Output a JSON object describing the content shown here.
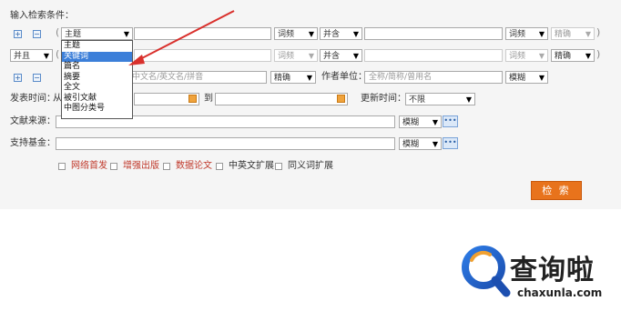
{
  "header": {
    "title": "输入检索条件："
  },
  "row1": {
    "field_select": "主题",
    "freq1": "词频",
    "logic": "并含",
    "freq2": "词频",
    "match": "精确"
  },
  "field_dropdown": {
    "options": [
      "主题",
      "关键词",
      "篇名",
      "摘要",
      "全文",
      "被引文献",
      "中图分类号"
    ],
    "highlighted_index": 1
  },
  "row2": {
    "conj": "并且",
    "freq1": "词频",
    "logic": "并含",
    "freq2": "词频",
    "match": "精确"
  },
  "row3": {
    "author_placeholder": "中文名/英文名/拼音",
    "author_match": "精确",
    "unit_label": "作者单位：",
    "unit_placeholder": "全称/简称/曾用名",
    "unit_match": "模糊"
  },
  "date_row": {
    "label": "发表时间：",
    "from": "从",
    "to": "到",
    "update_label": "更新时间：",
    "update_value": "不限"
  },
  "source_row": {
    "label": "文献来源：",
    "match": "模糊",
    "more": "•••"
  },
  "fund_row": {
    "label": "支持基金：",
    "match": "模糊",
    "more": "•••"
  },
  "checkboxes": [
    {
      "label": "网络首发",
      "color": "#c0392b"
    },
    {
      "label": "增强出版",
      "color": "#c0392b"
    },
    {
      "label": "数据论文",
      "color": "#c0392b"
    },
    {
      "label": "中英文扩展",
      "color": "#333333"
    },
    {
      "label": "同义词扩展",
      "color": "#333333"
    }
  ],
  "search_button": "检 索",
  "watermark": {
    "name": "查询啦",
    "url": "chaxunla.com"
  },
  "colors": {
    "accent": "#e8731c",
    "arrow": "#d9302c",
    "highlight": "#3c7fd9"
  }
}
